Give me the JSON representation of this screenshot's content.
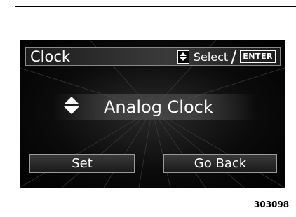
{
  "screen": {
    "title": "Clock",
    "hint": {
      "updown_icon": "up-down-arrows-icon",
      "select_label": "Select",
      "separator": "/",
      "enter_label": "ENTER"
    },
    "item": {
      "arrows_icon": "up-down-arrows-icon",
      "label": "Analog Clock"
    },
    "buttons": {
      "set": "Set",
      "go_back": "Go Back"
    }
  },
  "figure_code": "303098",
  "colors": {
    "screen_bg": "#000000",
    "text": "#ffffff",
    "border": "#9a9a9a"
  }
}
